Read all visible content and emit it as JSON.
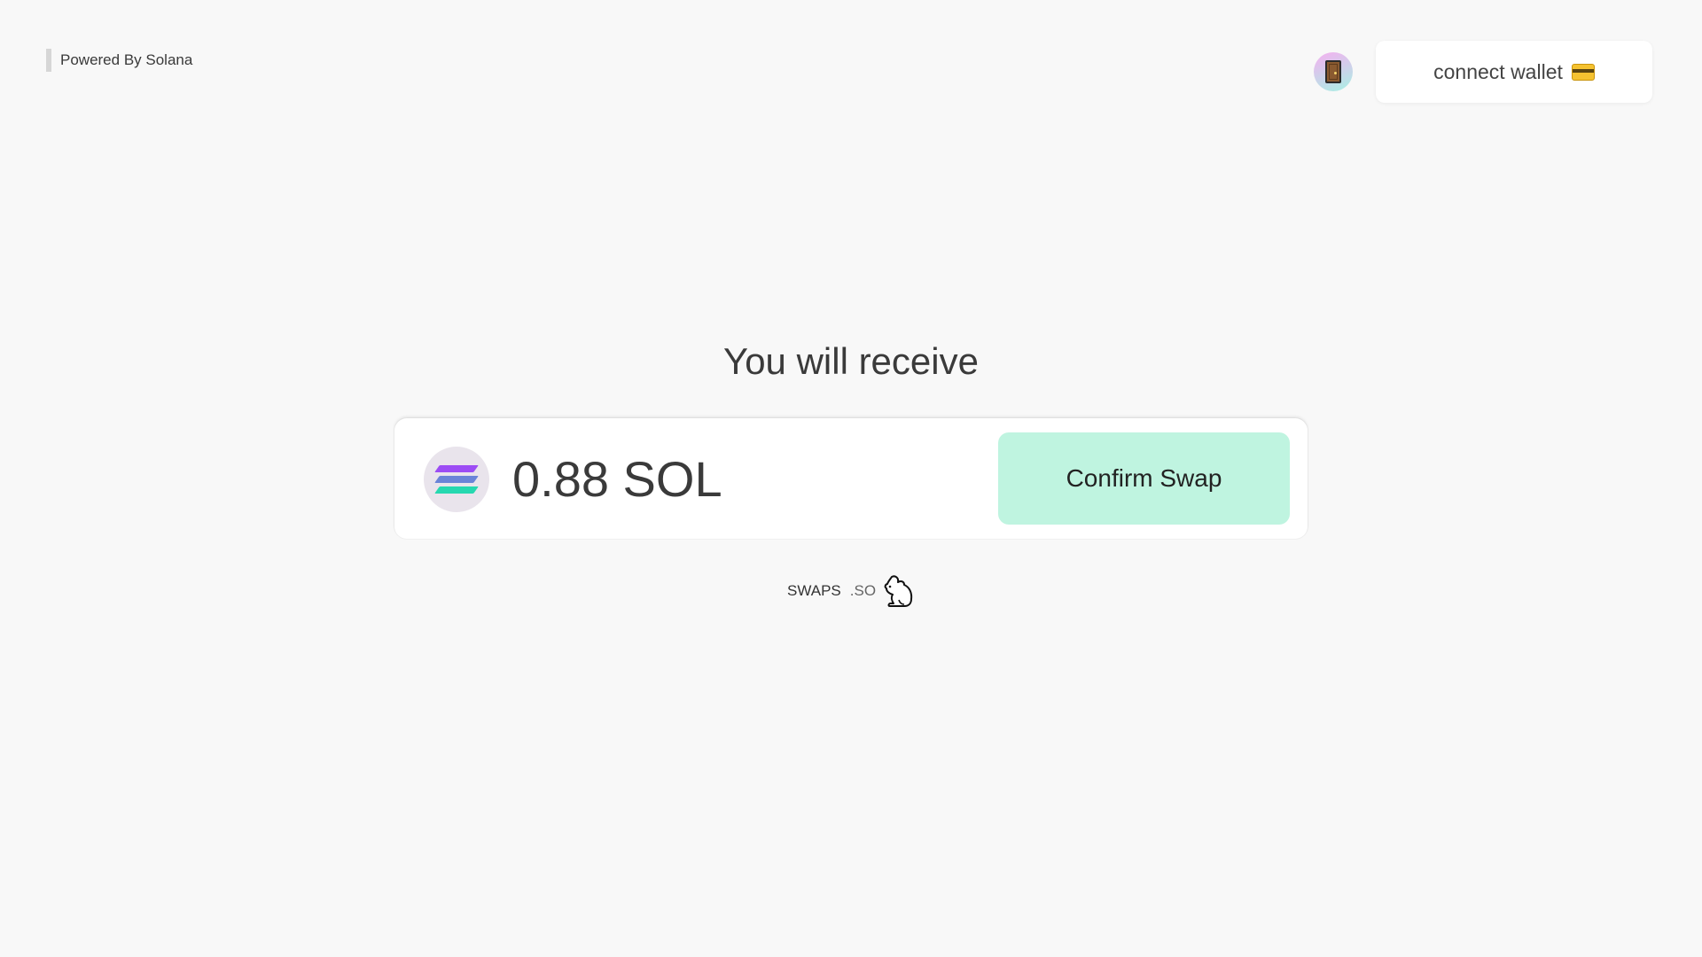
{
  "header": {
    "powered_by": "Powered By Solana",
    "avatar_icon": "door-icon",
    "connect_wallet_label": "connect wallet",
    "wallet_icon": "credit-card-icon"
  },
  "main": {
    "heading": "You will receive",
    "token_icon": "solana-logo-icon",
    "amount": "0.88 SOL",
    "confirm_label": "Confirm Swap"
  },
  "footer": {
    "brand_name": "SWAPS",
    "brand_suffix": ".SO",
    "brand_icon": "rabbit-icon"
  },
  "colors": {
    "background": "#f8f8f8",
    "confirm_button": "#bff4e0",
    "solana_gradient_top": "#9945ff",
    "solana_gradient_bottom": "#14f195"
  }
}
